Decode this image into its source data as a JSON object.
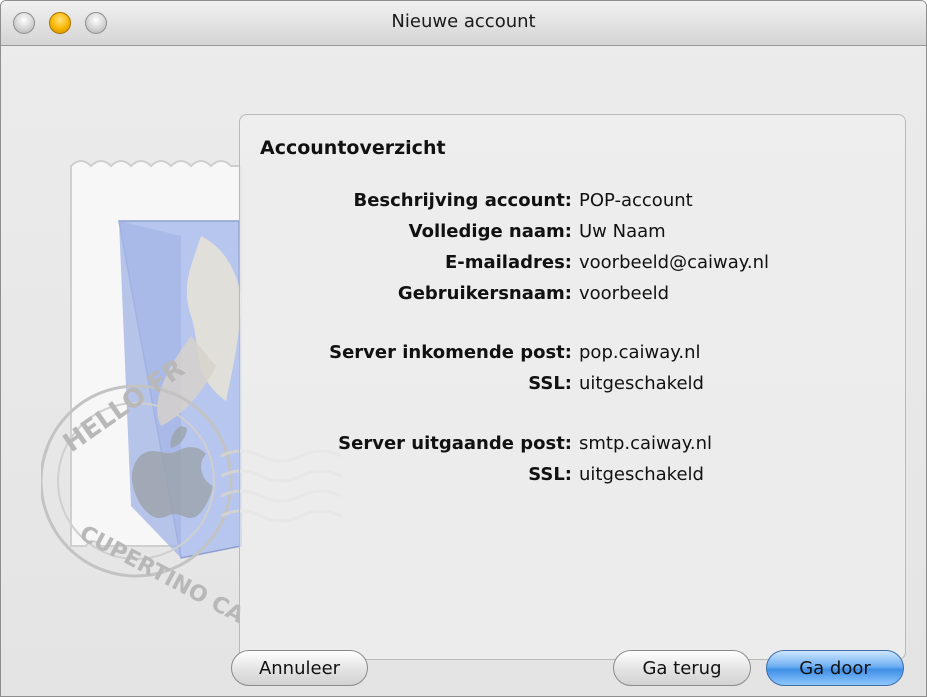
{
  "window": {
    "title": "Nieuwe account"
  },
  "summary": {
    "heading": "Accountoverzicht",
    "rows": [
      {
        "label": "Beschrijving account:",
        "value": "POP-account"
      },
      {
        "label": "Volledige naam:",
        "value": "Uw Naam"
      },
      {
        "label": "E-mailadres:",
        "value": "voorbeeld@caiway.nl"
      },
      {
        "label": "Gebruikersnaam:",
        "value": "voorbeeld"
      },
      {
        "label": "Server inkomende post:",
        "value": "pop.caiway.nl"
      },
      {
        "label": "SSL:",
        "value": "uitgeschakeld"
      },
      {
        "label": "Server uitgaande post:",
        "value": "smtp.caiway.nl"
      },
      {
        "label": "SSL:",
        "value": "uitgeschakeld"
      }
    ]
  },
  "stamp": {
    "text_top": "HELLO FR",
    "text_bottom": "CUPERTINO CA"
  },
  "buttons": {
    "cancel": "Annuleer",
    "back": "Ga terug",
    "continue": "Ga door"
  },
  "colors": {
    "default_button": "#3f8fe6",
    "stamp_blue": "#b7c6ee"
  },
  "icons": [
    "close-icon",
    "minimize-icon",
    "zoom-icon",
    "mail-stamp-icon"
  ]
}
